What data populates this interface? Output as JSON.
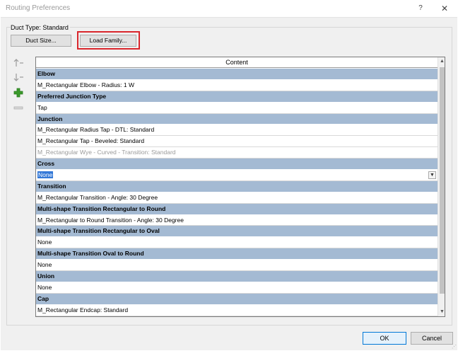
{
  "window": {
    "title": "Routing Preferences",
    "help_label": "?",
    "close_label": "✕"
  },
  "duct_type_label": "Duct Type: Standard",
  "toolbar": {
    "duct_size_label": "Duct Size...",
    "load_family_label": "Load Family..."
  },
  "side_tools": {
    "move_up_icon": "arrow-up-icon",
    "move_down_icon": "arrow-down-icon",
    "add_icon": "plus-icon",
    "remove_icon": "minus-icon",
    "add_color": "#3a9a2b"
  },
  "grid": {
    "header": "Content",
    "rows": [
      {
        "type": "section",
        "text": "Elbow"
      },
      {
        "type": "item",
        "text": "M_Rectangular Elbow - Radius: 1 W"
      },
      {
        "type": "section",
        "text": "Preferred Junction Type"
      },
      {
        "type": "item",
        "text": "Tap"
      },
      {
        "type": "section",
        "text": "Junction"
      },
      {
        "type": "item",
        "text": "M_Rectangular Radius Tap - DTL: Standard"
      },
      {
        "type": "item",
        "text": "M_Rectangular Tap - Beveled: Standard"
      },
      {
        "type": "item-dim",
        "text": "M_Rectangular Wye - Curved - Transition: Standard"
      },
      {
        "type": "section",
        "text": "Cross"
      },
      {
        "type": "item-selected",
        "text": "None"
      },
      {
        "type": "section",
        "text": "Transition"
      },
      {
        "type": "item",
        "text": "M_Rectangular Transition - Angle: 30 Degree"
      },
      {
        "type": "section",
        "text": "Multi-shape Transition Rectangular to Round"
      },
      {
        "type": "item",
        "text": "M_Rectangular to Round Transition - Angle: 30 Degree"
      },
      {
        "type": "section",
        "text": "Multi-shape Transition Rectangular to Oval"
      },
      {
        "type": "item",
        "text": "None"
      },
      {
        "type": "section",
        "text": "Multi-shape Transition Oval to Round"
      },
      {
        "type": "item",
        "text": "None"
      },
      {
        "type": "section",
        "text": "Union"
      },
      {
        "type": "item",
        "text": "None"
      },
      {
        "type": "section",
        "text": "Cap"
      },
      {
        "type": "item",
        "text": "M_Rectangular Endcap: Standard"
      },
      {
        "type": "item",
        "text": ""
      }
    ]
  },
  "footer": {
    "ok_label": "OK",
    "cancel_label": "Cancel"
  },
  "colors": {
    "section_bg": "#a4bad3",
    "selection": "#3378d7",
    "highlight_box": "#d9262c"
  }
}
